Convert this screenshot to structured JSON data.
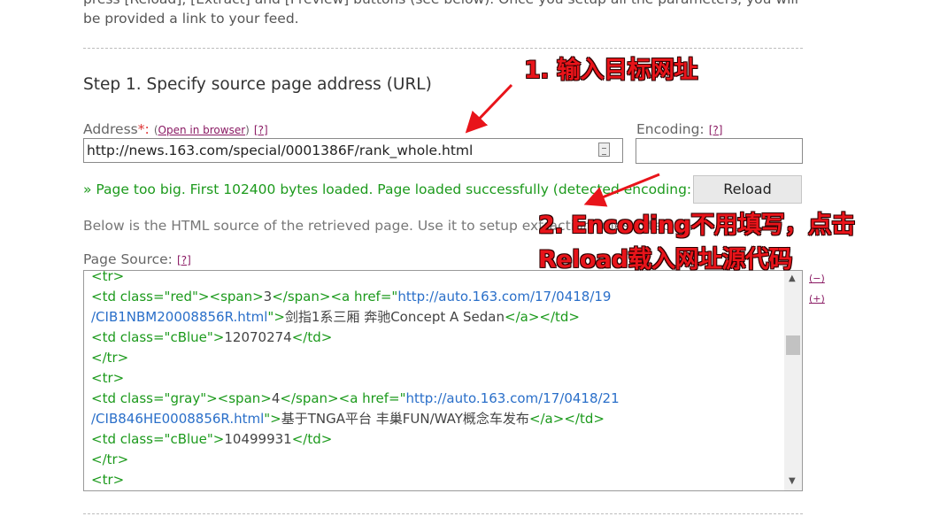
{
  "intro_text": "press [Reload], [Extract] and [Preview] buttons (see below). Once you setup all the parameters, you will be provided a link to your feed.",
  "step1": {
    "title": "Step 1. Specify source page address (URL)",
    "address_label": "Address",
    "required_mark": "*:",
    "open_in_browser": "Open in browser",
    "help": "[?]",
    "address_value": "http://news.163.com/special/0001386F/rank_whole.html",
    "encoding_label": "Encoding:",
    "encoding_value": "",
    "status": "» Page too big. First 102400 bytes loaded. Page loaded successfully (detected encoding: GBK)",
    "reload_label": "Reload",
    "below_text": "Below is the HTML source of the retrieved page. Use it to setup extraction rules (Step 2).",
    "page_source_label": "Page Source:",
    "minus": "(−)",
    "plus": "(+)"
  },
  "source_lines": [
    [
      {
        "t": "<tr>",
        "c": "tg"
      }
    ],
    [
      {
        "t": "<td class=\"red\">",
        "c": "tg"
      },
      {
        "t": "<span>",
        "c": "tg"
      },
      {
        "t": "3",
        "c": "tx"
      },
      {
        "t": "</span>",
        "c": "tg"
      },
      {
        "t": "<a href=\"",
        "c": "tg"
      },
      {
        "t": "http://auto.163.com/17/0418/19",
        "c": "lk"
      }
    ],
    [
      {
        "t": "/CIB1NBM20008856R.html",
        "c": "lk"
      },
      {
        "t": "\">",
        "c": "tg"
      },
      {
        "t": "剑指1系三厢 奔驰Concept A Sedan",
        "c": "tx"
      },
      {
        "t": "</a>",
        "c": "tg"
      },
      {
        "t": "</td>",
        "c": "tg"
      }
    ],
    [
      {
        "t": "<td class=\"cBlue\">",
        "c": "tg"
      },
      {
        "t": "12070274",
        "c": "tx"
      },
      {
        "t": "</td>",
        "c": "tg"
      }
    ],
    [
      {
        "t": "</tr>",
        "c": "tg"
      }
    ],
    [
      {
        "t": "<tr>",
        "c": "tg"
      }
    ],
    [
      {
        "t": "<td class=\"gray\">",
        "c": "tg"
      },
      {
        "t": "<span>",
        "c": "tg"
      },
      {
        "t": "4",
        "c": "tx"
      },
      {
        "t": "</span>",
        "c": "tg"
      },
      {
        "t": "<a href=\"",
        "c": "tg"
      },
      {
        "t": "http://auto.163.com/17/0418/21",
        "c": "lk"
      }
    ],
    [
      {
        "t": "/CIB846HE0008856R.html",
        "c": "lk"
      },
      {
        "t": "\">",
        "c": "tg"
      },
      {
        "t": "基于TNGA平台 丰巢FUN/WAY概念车发布",
        "c": "tx"
      },
      {
        "t": "</a>",
        "c": "tg"
      },
      {
        "t": "</td>",
        "c": "tg"
      }
    ],
    [
      {
        "t": "<td class=\"cBlue\">",
        "c": "tg"
      },
      {
        "t": "10499931",
        "c": "tx"
      },
      {
        "t": "</td>",
        "c": "tg"
      }
    ],
    [
      {
        "t": "</tr>",
        "c": "tg"
      }
    ],
    [
      {
        "t": "<tr>",
        "c": "tg"
      }
    ]
  ],
  "annotations": {
    "a1": "1. 输入目标网址",
    "a2_line1": "2. Encoding不用填写，点击",
    "a2_line2": "Reload载入网址源代码"
  },
  "colors": {
    "status_green": "#1c9a1c",
    "link_blue": "#2a6fc9",
    "annotation_red": "#e8141a"
  }
}
